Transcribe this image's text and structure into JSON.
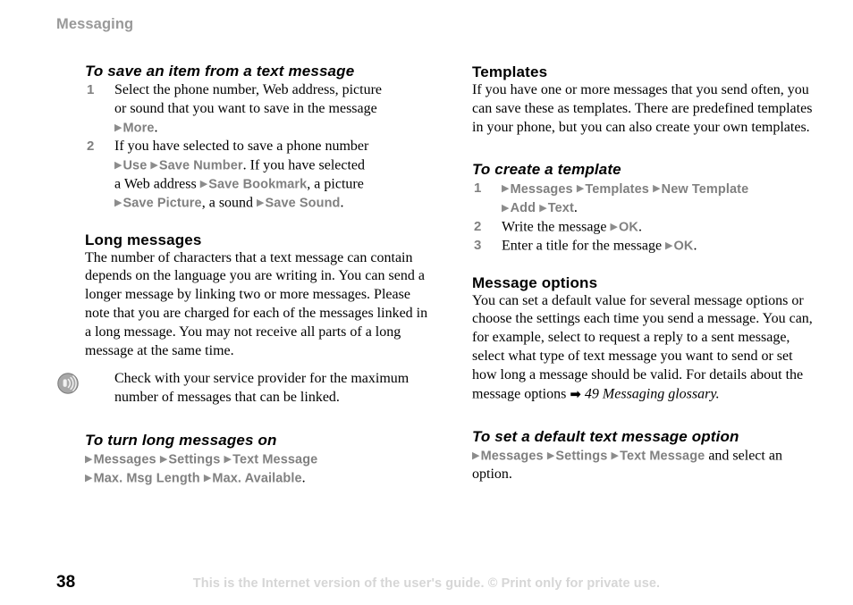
{
  "page": {
    "running_head": "Messaging",
    "page_number": "38",
    "footer_note": "This is the Internet version of the user's guide. © Print only for private use.",
    "colors": {
      "running_head": "#999999",
      "menu_reference": "#808080",
      "body_text": "#000000",
      "footer_note": "#d6d6d6",
      "note_icon": "#8a8a8a"
    },
    "glyphs": {
      "menu_triangle": "▶",
      "cross_reference_arrow": "➡"
    }
  },
  "left_column": {
    "procedure_save_item": {
      "heading": "To save an item from a text message",
      "steps": [
        {
          "number": "1",
          "line1": "Select the phone number, Web address, picture",
          "line2": "or sound that you want to save in the message",
          "menu1": "More",
          "tail1": "."
        },
        {
          "number": "2",
          "line1": "If you have selected to save a phone number",
          "menu1": "Use",
          "menu2": "Save Number",
          "tail1": ". If you have selected",
          "line2": "a Web address",
          "menu3": "Save Bookmark",
          "tail2": ", a picture",
          "menu4": "Save Picture",
          "tail3": ", a sound",
          "menu5": "Save Sound",
          "tail4": "."
        }
      ]
    },
    "section_long_messages": {
      "heading": "Long messages",
      "body": "The number of characters that a text message can contain depends on the language you are writing in. You can send a longer message by linking two or more messages. Please note that you are charged for each of the messages linked in a long message. You may not receive all parts of a long message at the same time."
    },
    "note": {
      "icon": "tip-note-icon",
      "text": "Check with your service provider for the maximum number of messages that can be linked."
    },
    "procedure_turn_long_on": {
      "heading": "To turn long messages on",
      "menu1": "Messages",
      "menu2": "Settings",
      "menu3": "Text Message",
      "menu4": "Max. Msg Length",
      "menu5": "Max. Available",
      "tail": "."
    }
  },
  "right_column": {
    "section_templates": {
      "heading": "Templates",
      "body": "If you have one or more messages that you send often, you can save these as templates. There are predefined templates in your phone, but you can also create your own templates."
    },
    "procedure_create_template": {
      "heading": "To create a template",
      "steps": [
        {
          "number": "1",
          "menu1": "Messages",
          "menu2": "Templates",
          "menu3": "New Template",
          "menu4": "Add",
          "menu5": "Text",
          "tail": "."
        },
        {
          "number": "2",
          "text": "Write the message",
          "menu1": "OK",
          "tail": "."
        },
        {
          "number": "3",
          "text": "Enter a title for the message",
          "menu1": "OK",
          "tail": "."
        }
      ]
    },
    "section_message_options": {
      "heading": "Message options",
      "body": "You can set a default value for several message options or choose the settings each time you send a message. You can, for example, select to request a reply to a sent message, select what type of text message you want to send or set how long a message should be valid. For details about the message options",
      "cross_reference": "49 Messaging glossary."
    },
    "procedure_default_option": {
      "heading": "To set a default text message option",
      "menu1": "Messages",
      "menu2": "Settings",
      "menu3": "Text Message",
      "tail": " and select an option."
    }
  }
}
